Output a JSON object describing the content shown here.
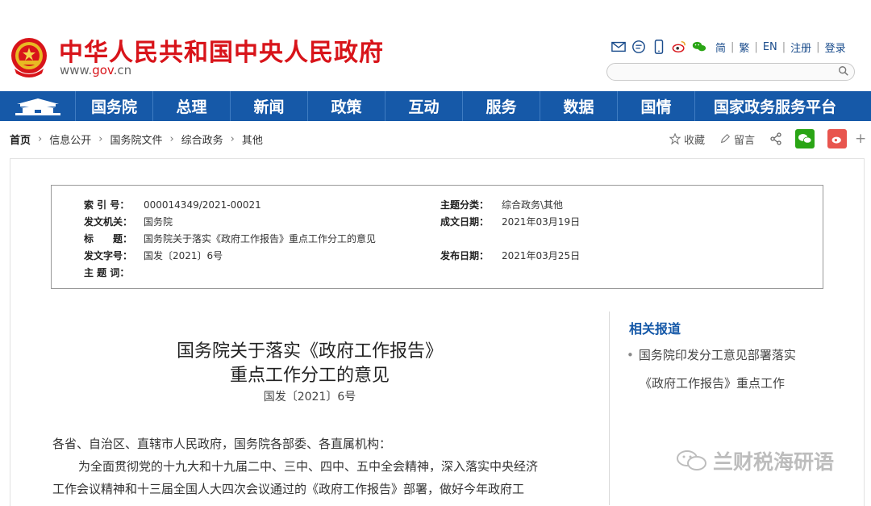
{
  "header": {
    "site_title": "中华人民共和国中央人民政府",
    "site_url_prefix": "www.",
    "site_url_accent": "gov",
    "site_url_suffix": ".cn",
    "lang_simplified": "简",
    "lang_traditional": "繁",
    "lang_english": "EN",
    "register": "注册",
    "login": "登录",
    "separator": "|",
    "icons": [
      "mail-icon",
      "message-icon",
      "mobile-icon",
      "weibo-icon",
      "wechat-icon"
    ],
    "brand_color": "#d8141a"
  },
  "nav": {
    "bg_color": "#1659a8",
    "items": [
      "国务院",
      "总理",
      "新闻",
      "政策",
      "互动",
      "服务",
      "数据",
      "国情",
      "国家政务服务平台"
    ]
  },
  "breadcrumb": {
    "items": [
      "首页",
      "信息公开",
      "国务院文件",
      "综合政务",
      "其他"
    ]
  },
  "actions": {
    "favorite": "收藏",
    "comment": "留言",
    "more": "+"
  },
  "meta": {
    "index_label": "索 引 号：",
    "index_value": "000014349/2021-00021",
    "topic_label": "主题分类：",
    "topic_value": "综合政务\\其他",
    "issuer_label": "发文机关：",
    "issuer_value": "国务院",
    "created_label": "成文日期：",
    "created_value": "2021年03月19日",
    "title_label": "标　　题：",
    "title_value": "国务院关于落实《政府工作报告》重点工作分工的意见",
    "docno_label": "发文字号：",
    "docno_value": "国发〔2021〕6号",
    "published_label": "发布日期：",
    "published_value": "2021年03月25日",
    "keywords_label": "主 题 词："
  },
  "article": {
    "title_line1": "国务院关于落实《政府工作报告》",
    "title_line2": "重点工作分工的意见",
    "doc_number": "国发〔2021〕6号",
    "salutation": "各省、自治区、直辖市人民政府，国务院各部委、各直属机构：",
    "para_line1": "为全面贯彻党的十九大和十九届二中、三中、四中、五中全会精神，深入落实中央经济",
    "para_line2": "工作会议精神和十三届全国人大四次会议通过的《政府工作报告》部署，做好今年政府工"
  },
  "related": {
    "title": "相关报道",
    "bullet": "•",
    "item1_line1": "国务院印发分工意见部署落实",
    "item1_line2": "《政府工作报告》重点工作"
  },
  "watermark": {
    "text": "兰财税海研语"
  }
}
